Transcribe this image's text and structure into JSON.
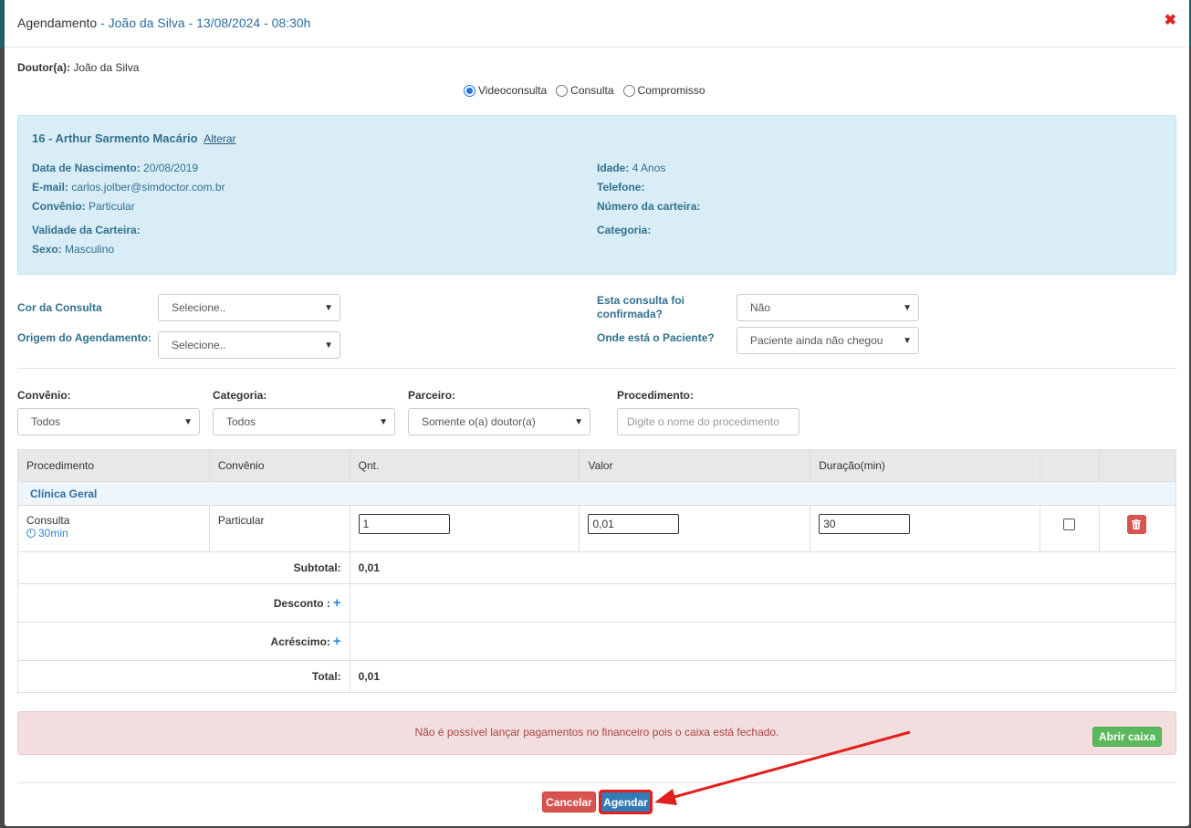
{
  "modal": {
    "title_prefix": "Agendamento",
    "title_sep": " - ",
    "title_detail": "João da Silva - 13/08/2024 - 08:30h",
    "close_icon": "✖"
  },
  "doctor": {
    "label": "Doutor(a):",
    "value": "João da Silva"
  },
  "appointment_type": {
    "options": [
      "Videoconsulta",
      "Consulta",
      "Compromisso"
    ],
    "selected": "Videoconsulta"
  },
  "patient": {
    "name": "16 - Arthur Sarmento Macário",
    "change_link": "Alterar",
    "birth_label": "Data de Nascimento:",
    "birth_value": "20/08/2019",
    "age_label": "Idade:",
    "age_value": "4 Anos",
    "email_label": "E-mail:",
    "email_value": "carlos.jolber@simdoctor.com.br",
    "phone_label": "Telefone:",
    "insurance_label": "Convênio:",
    "insurance_value": "Particular",
    "card_number_label": "Número da carteira:",
    "card_validity_label": "Validade da Carteira:",
    "category_label": "Categoria:",
    "sex_label": "Sexo:",
    "sex_value": "Masculino"
  },
  "form": {
    "color_label": "Cor da Consulta",
    "color_value": "Selecione..",
    "origin_label": "Origem do Agendamento:",
    "origin_value": "Selecione..",
    "confirmed_label": "Esta consulta foi confirmada?",
    "confirmed_value": "Não",
    "location_label": "Onde está o Paciente?",
    "location_value": "Paciente ainda não chegou"
  },
  "filters": {
    "insurance_label": "Convênio:",
    "insurance_value": "Todos",
    "category_label": "Categoria:",
    "category_value": "Todos",
    "partner_label": "Parceiro:",
    "partner_value": "Somente o(a) doutor(a)",
    "procedure_label": "Procedimento:",
    "procedure_placeholder": "Digite o nome do procedimento"
  },
  "table": {
    "headers": [
      "Procedimento",
      "Convênio",
      "Qnt.",
      "Valor",
      "Duração(min)"
    ],
    "group": "Clínica Geral",
    "row": {
      "procedure": "Consulta",
      "duration_label": "30min",
      "insurance": "Particular",
      "qty": "1",
      "value": "0,01",
      "duration": "30"
    },
    "subtotal_label": "Subtotal:",
    "subtotal_value": "0,01",
    "discount_label": "Desconto :",
    "surcharge_label": "Acréscimo:",
    "total_label": "Total:",
    "total_value": "0,01"
  },
  "alert": {
    "message": "Não é possível lançar pagamentos no financeiro pois o caixa está fechado.",
    "open_cash_button": "Abrir caixa"
  },
  "footer": {
    "cancel_button": "Cancelar",
    "schedule_button": "Agendar"
  },
  "colors": {
    "accent": "#2c6da4",
    "danger": "#d9534f",
    "success": "#5cb85c",
    "primary": "#337ab7",
    "annotation": "#e0201d"
  }
}
